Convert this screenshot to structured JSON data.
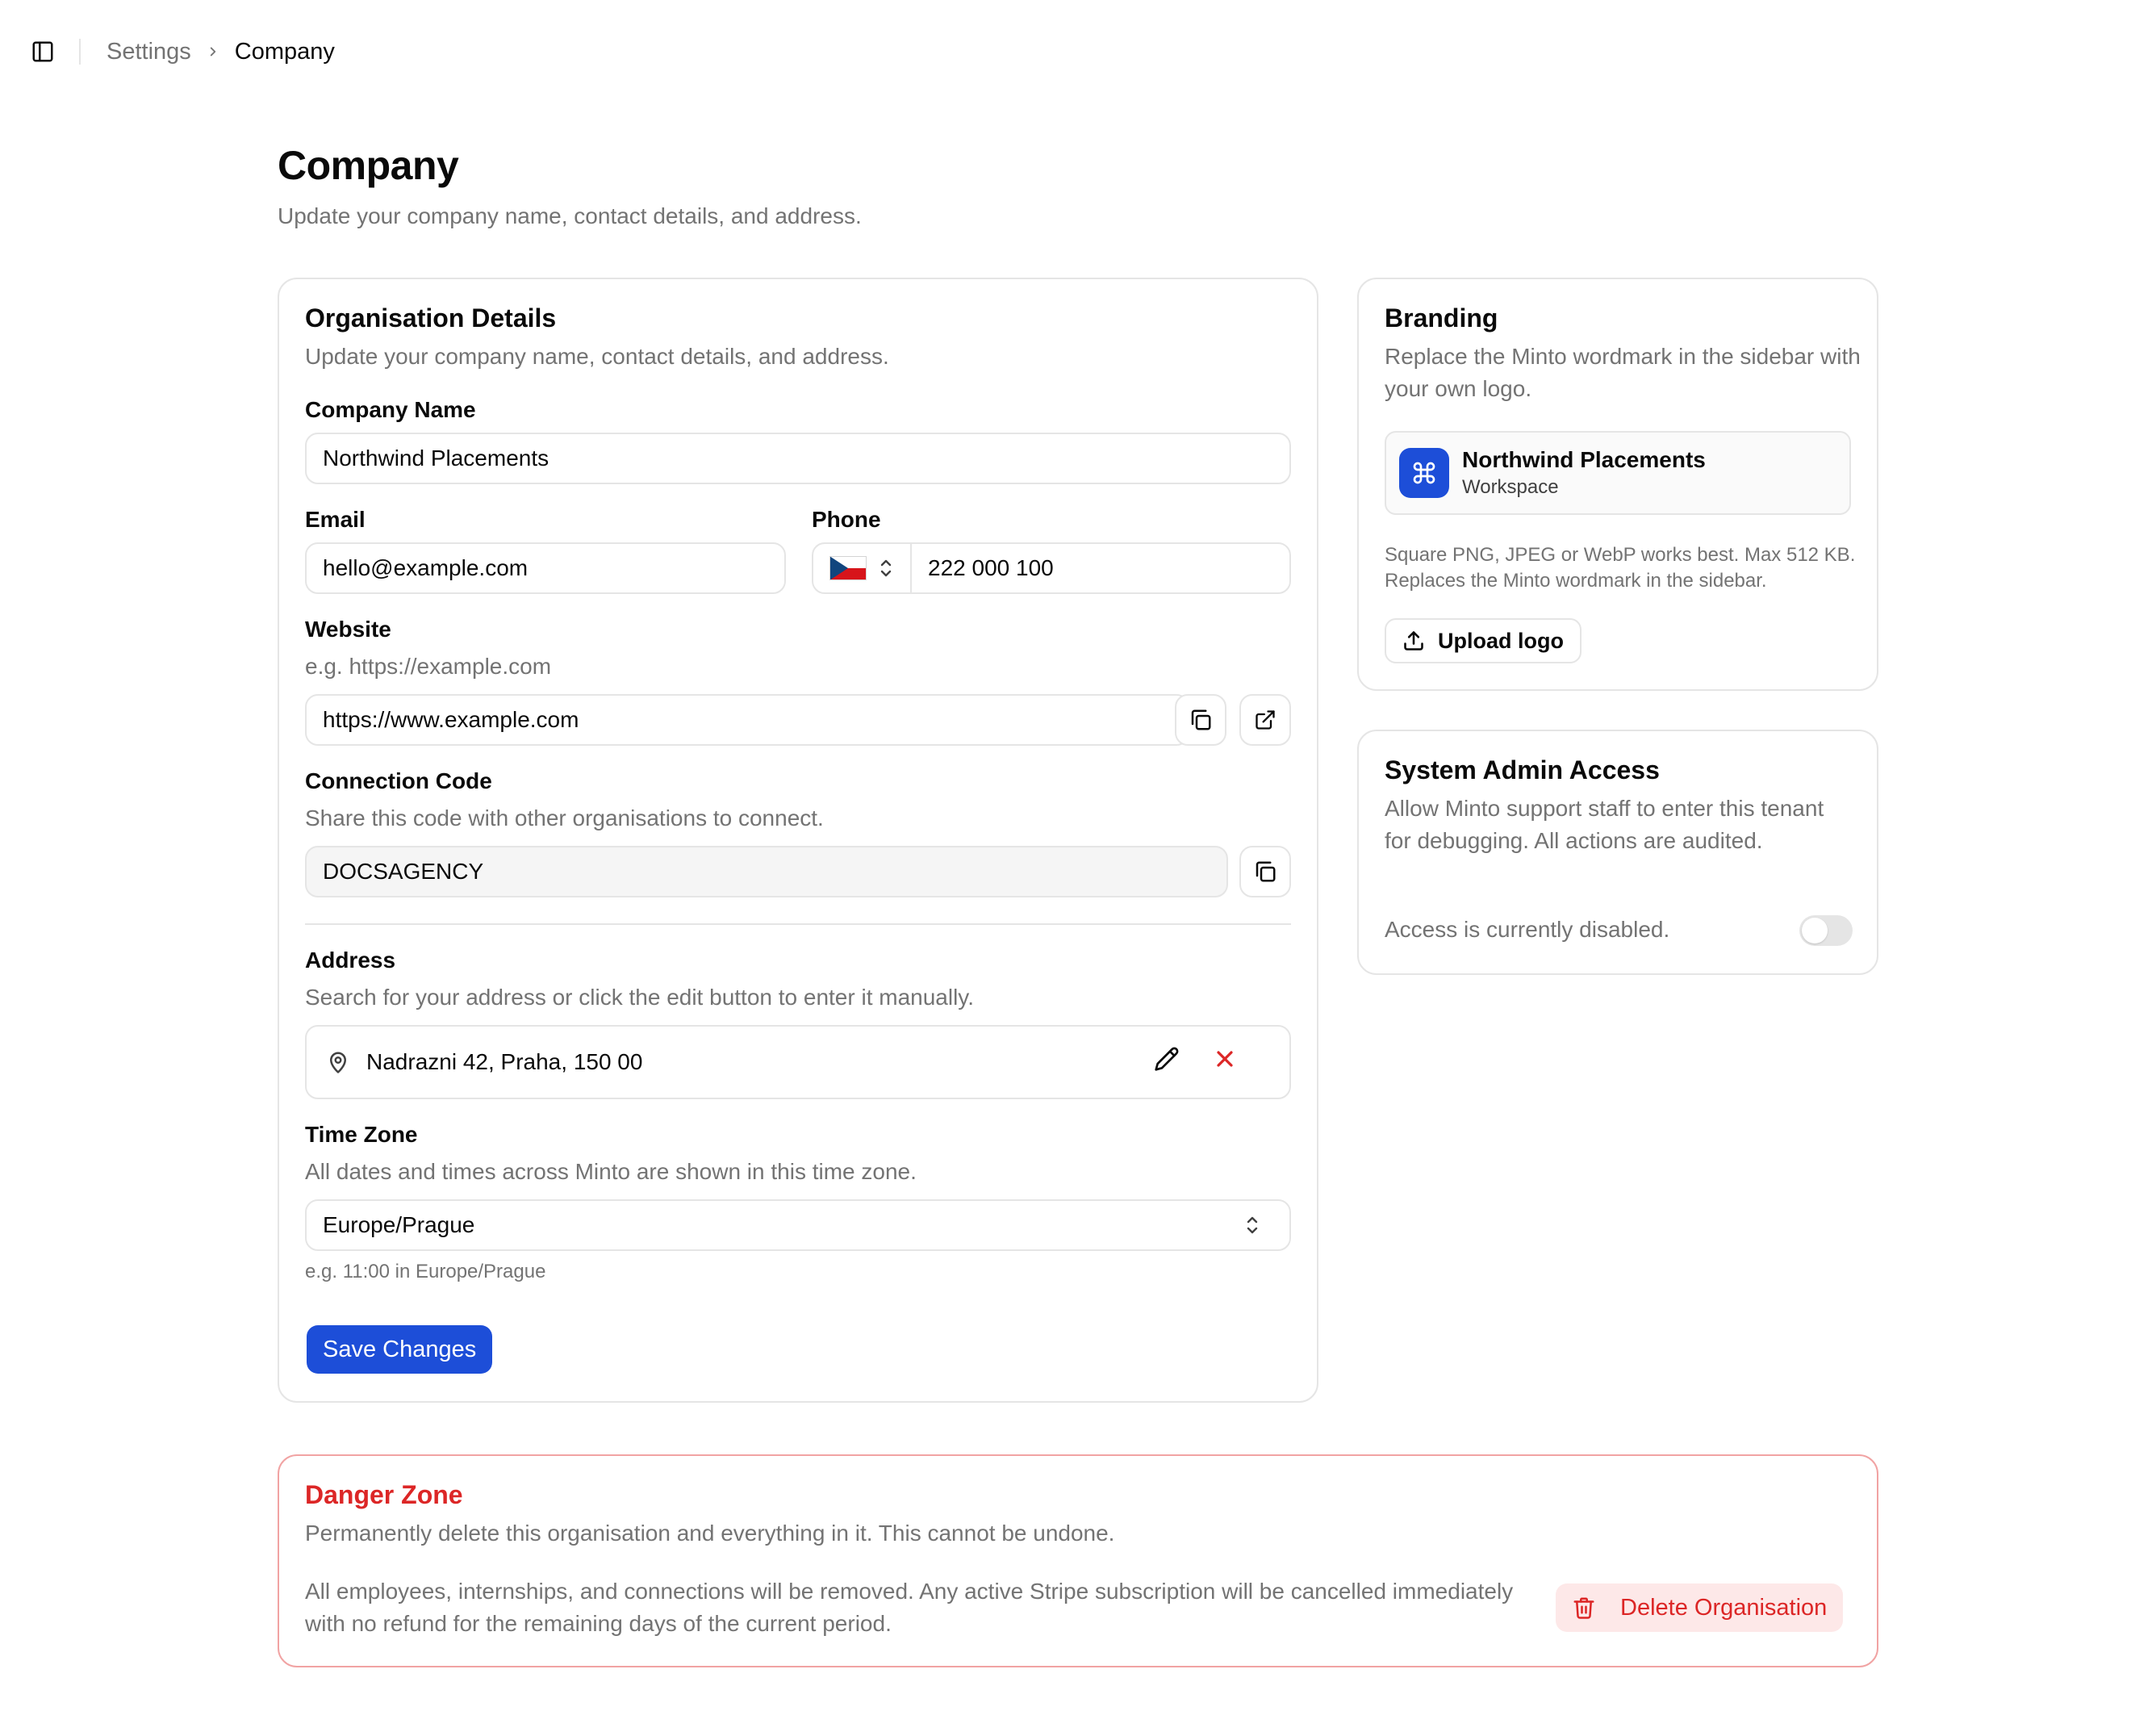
{
  "breadcrumb": {
    "parent": "Settings",
    "current": "Company"
  },
  "header": {
    "title": "Company",
    "subtitle": "Update your company name, contact details, and address."
  },
  "org": {
    "title": "Organisation Details",
    "desc": "Update your company name, contact details, and address.",
    "company_name_label": "Company Name",
    "company_name_value": "Northwind Placements",
    "email_label": "Email",
    "email_value": "hello@example.com",
    "phone_label": "Phone",
    "phone_country_flag": "czech-flag-icon",
    "phone_value": "222 000 100",
    "website_label": "Website",
    "website_help": "e.g. https://example.com",
    "website_value": "https://www.example.com",
    "connection_label": "Connection Code",
    "connection_help": "Share this code with other organisations to connect.",
    "connection_value": "DOCSAGENCY",
    "address_label": "Address",
    "address_help": "Search for your address or click the edit button to enter it manually.",
    "address_value": "Nadrazni 42, Praha, 150 00",
    "timezone_label": "Time Zone",
    "timezone_help": "All dates and times across Minto are shown in this time zone.",
    "timezone_value": "Europe/Prague",
    "timezone_example": "e.g. 11:00 in Europe/Prague",
    "save_label": "Save Changes"
  },
  "branding": {
    "title": "Branding",
    "desc": "Replace the Minto wordmark in the sidebar with your own logo.",
    "workspace_name": "Northwind Placements",
    "workspace_sub": "Workspace",
    "note": "Square PNG, JPEG or WebP works best. Max 512 KB. Replaces the Minto wordmark in the sidebar.",
    "upload_label": "Upload logo"
  },
  "admin": {
    "title": "System Admin Access",
    "desc": "Allow Minto support staff to enter this tenant for debugging. All actions are audited.",
    "status": "Access is currently disabled.",
    "enabled": false
  },
  "danger": {
    "title": "Danger Zone",
    "desc": "Permanently delete this organisation and everything in it. This cannot be undone.",
    "detail": "All employees, internships, and connections will be removed. Any active Stripe subscription will be cancelled immediately with no refund for the remaining days of the current period.",
    "delete_label": "Delete Organisation"
  },
  "colors": {
    "accent": "#1d4ed8",
    "danger": "#dc2626",
    "brand_icon_bg": "#1d4ed8"
  }
}
